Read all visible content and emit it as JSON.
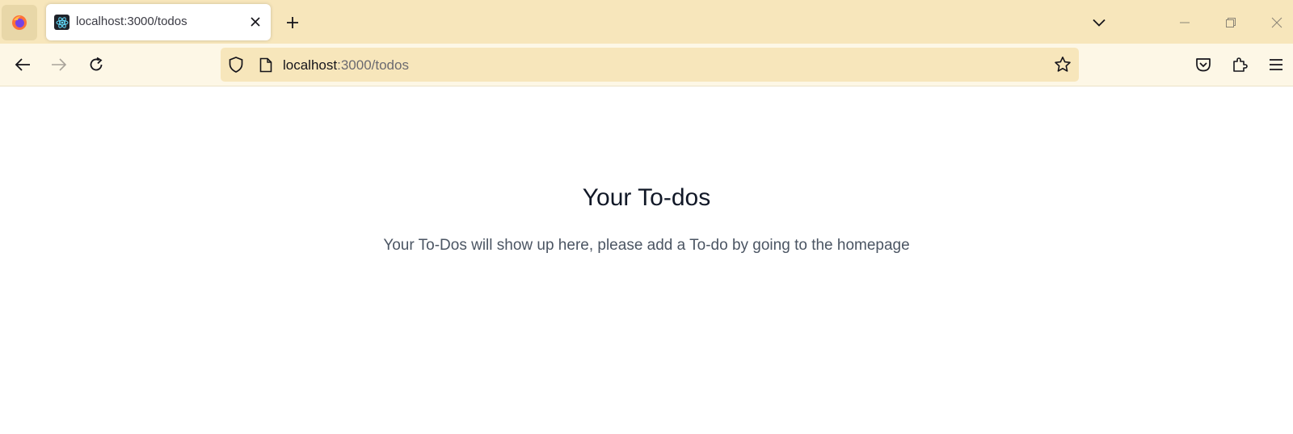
{
  "browser": {
    "tab": {
      "title": "localhost:3000/todos"
    },
    "address_bar": {
      "host": "localhost",
      "path": ":3000/todos"
    },
    "icons": {
      "app": "firefox-icon",
      "favicon": "react-icon",
      "close_tab": "close-icon",
      "new_tab": "plus-icon",
      "tab_list": "chevron-down-icon",
      "minimize": "minimize-icon",
      "restore": "restore-icon",
      "close_window": "close-icon",
      "back": "arrow-left-icon",
      "forward": "arrow-right-icon",
      "reload": "reload-icon",
      "tracking": "shield-icon",
      "page_info": "page-icon",
      "bookmark": "star-icon",
      "pocket": "pocket-icon",
      "extensions": "puzzle-icon",
      "menu": "hamburger-icon"
    },
    "colors": {
      "tabstrip": "#f7e6bb",
      "navbar": "#fdf7e6",
      "urlbar": "#f7e6bb"
    }
  },
  "page": {
    "title": "Your To-dos",
    "subtitle": "Your To-Dos will show up here, please add a To-do by going to the homepage",
    "colors": {
      "title": "#111827",
      "subtitle": "#4b5563"
    }
  }
}
